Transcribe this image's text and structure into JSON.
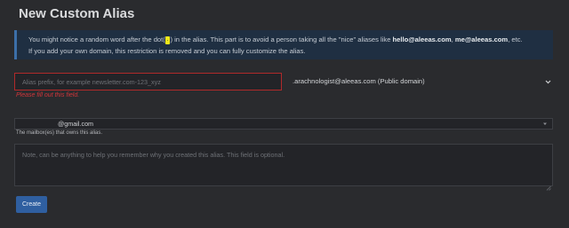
{
  "page": {
    "title": "New Custom Alias"
  },
  "info": {
    "line1_a": "You might notice a random word after the dot(",
    "dot_mark": ".",
    "line1_b": ") in the alias. This part is to avoid a person taking all the \"nice\" aliases like ",
    "example1": "hello@aleeas.com",
    "sep": ", ",
    "example2": "me@aleeas.com",
    "line1_c": ", etc.",
    "line2": "If you add your own domain, this restriction is removed and you can fully customize the alias."
  },
  "form": {
    "prefix_placeholder": "Alias prefix, for example newsletter.com-123_xyz",
    "prefix_value": "",
    "prefix_error": "Please fill out this field.",
    "domain_selected": ".arachnologist@aleeas.com (Public domain)",
    "mailbox_selected": "@gmail.com",
    "mailbox_help": "The mailbox(es) that owns this alias.",
    "note_placeholder": "Note, can be anything to help you remember why you created this alias. This field is optional.",
    "note_value": "",
    "create_label": "Create"
  },
  "icons": {
    "domain_chevron": "chevron-down-icon",
    "mailbox_chevron": "caret-down-icon",
    "resize_grip": "resize-grip-icon"
  },
  "colors": {
    "background": "#2a2b2e",
    "info_background": "#1f2f42",
    "info_border": "#3c6fa8",
    "error": "#d0353a",
    "primary_button": "#2f5fa0",
    "highlight": "#f0e81a"
  }
}
